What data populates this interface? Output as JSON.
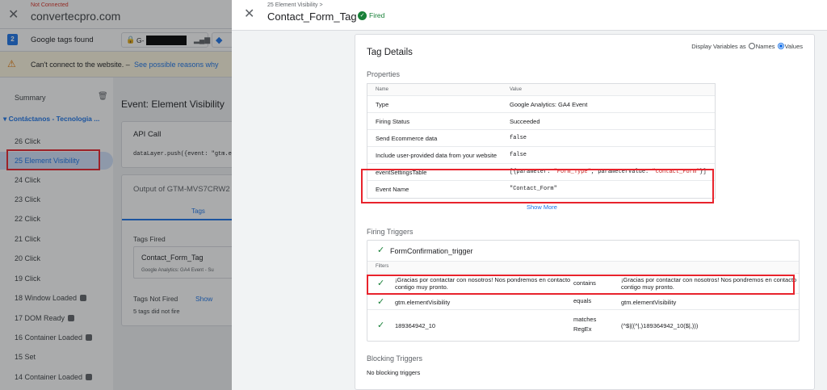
{
  "topbar": {
    "status": "Not Connected",
    "domain": "convertecpro.com"
  },
  "tags_bar": {
    "count": "2",
    "label": "Google tags found",
    "tag_id": "G-"
  },
  "warning": {
    "text": "Can't connect to the website.  –",
    "link": "See possible reasons why"
  },
  "sidebar": {
    "summary": "Summary",
    "page_header": "Contáctanos - Tecnologia ...",
    "events": [
      {
        "label": "26  Click"
      },
      {
        "label": "25  Element Visibility"
      },
      {
        "label": "24  Click"
      },
      {
        "label": "23  Click"
      },
      {
        "label": "22  Click"
      },
      {
        "label": "21  Click"
      },
      {
        "label": "20  Click"
      },
      {
        "label": "19  Click"
      },
      {
        "label": "18  Window Loaded"
      },
      {
        "label": "17  DOM Ready"
      },
      {
        "label": "16  Container Loaded"
      },
      {
        "label": "15  Set"
      },
      {
        "label": "14  Container Loaded"
      }
    ]
  },
  "main": {
    "event_title": "Event: Element Visibility",
    "api_call_title": "API Call",
    "api_call_code": "dataLayer.push({event: \"gtm.e",
    "output_title": "Output of GTM-MVS7CRW2",
    "tab_tags": "Tags",
    "tags_fired": "Tags Fired",
    "fired_tag_name": "Contact_Form_Tag",
    "fired_tag_sub": "Google Analytics: GA4 Event - Su",
    "tags_not_fired": "Tags Not Fired",
    "show_link": "Show",
    "did_not_fire": "5 tags did not fire"
  },
  "drawer": {
    "breadcrumb": "25 Element Visibility >",
    "title": "Contact_Form_Tag",
    "status": "Fired",
    "panel_title": "Tag Details",
    "display_vars_label": "Display Variables as",
    "opt_names": "Names",
    "opt_values": "Values",
    "properties_label": "Properties",
    "col_name": "Name",
    "col_value": "Value",
    "properties": [
      {
        "name": "Type",
        "value": "Google Analytics: GA4 Event"
      },
      {
        "name": "Firing Status",
        "value": "Succeeded"
      },
      {
        "name": "Send Ecommerce data",
        "value": "false"
      },
      {
        "name": "Include user-provided data from your website",
        "value": "false"
      },
      {
        "name": "eventSettingsTable",
        "value_prefix": "[{parameter: ",
        "value_p1": "\"Form_Type\"",
        "value_mid": ", parameterValue: ",
        "value_p2": "\"Contact_Form\"",
        "value_suffix": "}]"
      },
      {
        "name": "Event Name",
        "value": "\"Contact_Form\""
      }
    ],
    "show_more": "Show More",
    "firing_triggers_label": "Firing Triggers",
    "trigger_name": "FormConfirmation_trigger",
    "filters_label": "Filters",
    "filters": [
      {
        "left": "¡Gracias por contactar con nosotros! Nos pondremos en contacto contigo muy pronto.",
        "op": "contains",
        "right": "¡Gracias por contactar con nosotros! Nos pondremos en contacto contigo muy pronto."
      },
      {
        "left": "gtm.elementVisibility",
        "op": "equals",
        "right": "gtm.elementVisibility"
      },
      {
        "left": "189364942_10",
        "op": "matches RegEx",
        "right": "(^$|((^|,)189364942_10($|,)))"
      }
    ],
    "blocking_triggers_label": "Blocking Triggers",
    "no_blocking": "No blocking triggers"
  }
}
